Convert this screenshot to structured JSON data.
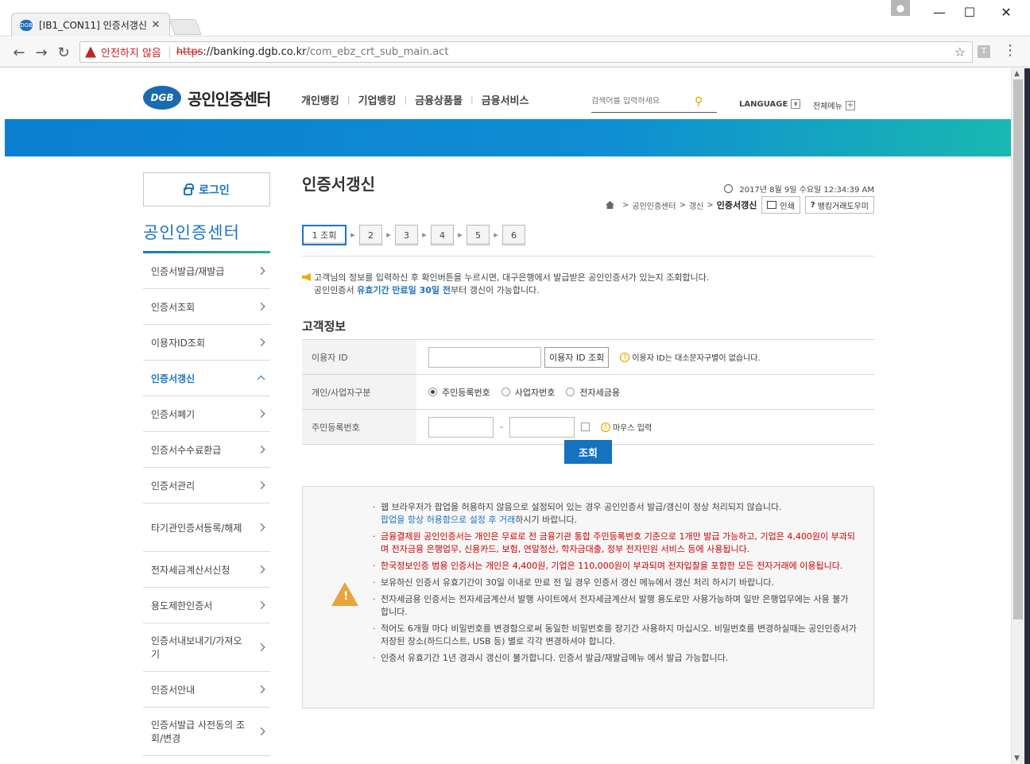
{
  "browser": {
    "tab_title": "[IB1_CON11] 인증서갱신",
    "not_secure_label": "안전하지 않음",
    "url_scheme": "https",
    "url_host": "://banking.dgb.co.kr",
    "url_path": "/com_ebz_crt_sub_main.act",
    "extension_letter": "T"
  },
  "header": {
    "logo_badge": "DGB",
    "logo_text": "공인인증센터",
    "gnb": [
      "개인뱅킹",
      "기업뱅킹",
      "금융상품몰",
      "금융서비스"
    ],
    "search_placeholder": "검색어를 입력하세요",
    "language_label": "LANGUAGE",
    "allmenu_label": "전체메뉴"
  },
  "sidebar": {
    "login_label": "로그인",
    "title": "공인인증센터",
    "items": [
      {
        "label": "인증서발급/재발급"
      },
      {
        "label": "인증서조회"
      },
      {
        "label": "이용자ID조회"
      },
      {
        "label": "인증서갱신"
      },
      {
        "label": "인증서폐기"
      },
      {
        "label": "인증서수수료환급"
      },
      {
        "label": "인증서관리"
      },
      {
        "label": "타기관인증서등록/해제"
      },
      {
        "label": "전자세금계산서신청"
      },
      {
        "label": "용도제한인증서"
      },
      {
        "label": "인증서내보내기/가져오기"
      },
      {
        "label": "인증서안내"
      },
      {
        "label": "인증서발급 사전동의 조회/변경"
      }
    ]
  },
  "main": {
    "title": "인증서갱신",
    "datetime": "2017년 8월 9일 수요일 12:34:39 AM",
    "breadcrumb": [
      "공인인증센터",
      "갱신",
      "인증서갱신"
    ],
    "print_label": "인쇄",
    "help_label": "뱅킹거래도우미",
    "steps": [
      "1 조회",
      "2",
      "3",
      "4",
      "5",
      "6"
    ],
    "notice_line1": "고객님의 정보를 입력하신 후 확인버튼을 누르시면, 대구은행에서 발급받은 공인인증서가 있는지 조회합니다.",
    "notice_line2_prefix": "공인인증서 ",
    "notice_line2_highlight": "유효기간 만료일 30일 전",
    "notice_line2_suffix": "부터 갱신이 가능합니다.",
    "section_title": "고객정보",
    "form": {
      "user_id_label": "이용자 ID",
      "user_id_value": "",
      "user_id_lookup_button": "이용자 ID 조회",
      "user_id_hint": "이용자 ID는 대소문자구별이 없습니다.",
      "type_label": "개인/사업자구분",
      "type_options": [
        "주민등록번호",
        "사업자번호",
        "전자세금용"
      ],
      "type_selected": "주민등록번호",
      "rrn_label": "주민등록번호",
      "rrn_first": "",
      "rrn_second": "",
      "mouse_input_label": "마우스 입력"
    },
    "submit_label": "조회",
    "guide": {
      "item1_prefix": "웹 브라우저가 팝업을 허용하지 않음으로 설정되어 있는 경우 공인인증서 발급/갱신이 정상 처리되지 않습니다.",
      "item1_link": "팝업을 항상 허용함으로 설정 후 거래",
      "item1_suffix": "하시기 바랍니다.",
      "item2": "금융결제원 공인인증서는 개인은 무료로 전 금융기관 통합 주민등록번호 기준으로 1개만 발급 가능하고, 기업은 4,400원이 부과되며 전자금융 은행업무, 신용카드, 보험, 연말정산, 학자금대출, 정부 전자민원 서비스 등에 사용됩니다.",
      "item3": "한국정보인증 범용 인증서는 개인은 4,400원, 기업은 110,000원이 부과되며 전자입찰을 포함한 모든 전자거래에 이용됩니다.",
      "item4": "보유하신 인증서 유효기간이 30일 이내로 만료 전 일 경우 인증서 갱신 메뉴에서 갱신 처리 하시기 바랍니다.",
      "item5": "전자세금용 인증서는 전자세금계산서 발행 사이트에서 전자세금계산서 발행 용도로만 사용가능하며 일반 은행업무에는 사용 불가 합니다.",
      "item6": "적어도 6개월 마다 비밀번호를 변경함으로써 동일한 비밀번호를 장기간 사용하지 마십시오. 비밀번호를 변경하실때는 공인인증서가 저장된 장소(하드디스트, USB 등) 별로 각각 변경하셔야 합니다.",
      "item7": "인증서 유효기간 1년 경과시 갱신이 불가합니다. 인증서 발급/재발급메뉴 에서 발급 가능합니다."
    }
  }
}
